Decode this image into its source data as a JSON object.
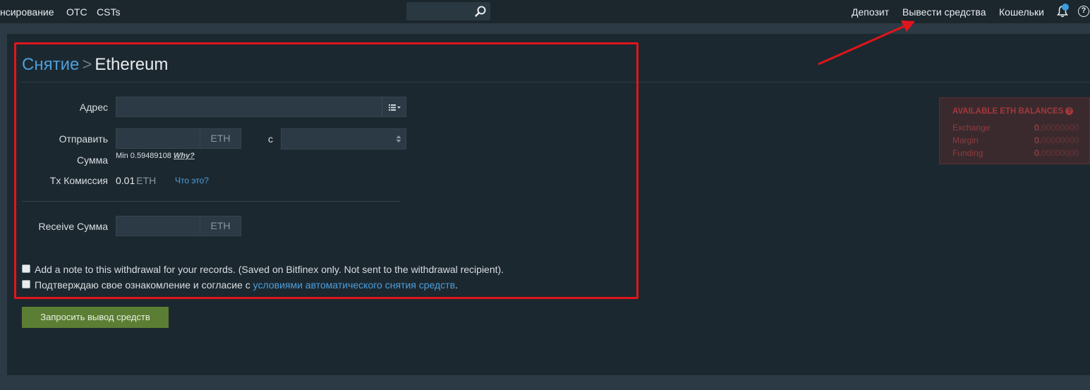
{
  "nav": {
    "left_items": [
      "нсирование",
      "OTC",
      "CSTs"
    ],
    "right_items": [
      "Депозит",
      "Вывести средства",
      "Кошельки"
    ]
  },
  "breadcrumb": {
    "parent": "Снятие",
    "separator": ">",
    "current": "Ethereum"
  },
  "form": {
    "address_label": "Адрес",
    "send_label_1": "Отправить",
    "send_label_2": "Сумма",
    "currency": "ETH",
    "from_label": "с",
    "min_text": "Min 0.59489108",
    "why_link": "Why?",
    "fee_label": "Tx Комиссия",
    "fee_value": "0.01",
    "fee_unit": "ETH",
    "fee_help_link": "Что это?",
    "receive_label": "Receive Сумма",
    "note_checkbox_text": "Add a note to this withdrawal for your records. (Saved on Bitfinex only. Not sent to the withdrawal recipient).",
    "terms_text_before": "Подтверждаю свое ознакомление и согласие с ",
    "terms_link": "условиями автоматического снятия средств",
    "terms_text_after": ".",
    "submit_label": "Запросить вывод средств"
  },
  "balances": {
    "title": "AVAILABLE ETH BALANCES",
    "rows": [
      {
        "label": "Exchange",
        "int": "0.",
        "dec": "00000000"
      },
      {
        "label": "Margin",
        "int": "0.",
        "dec": "00000000"
      },
      {
        "label": "Funding",
        "int": "0.",
        "dec": "00000000"
      }
    ]
  },
  "colors": {
    "accent_link": "#4c9fdc",
    "submit_green": "#5b7e34",
    "annotation_red": "#e0151b",
    "balance_red": "#a5373b"
  },
  "icons": [
    "search-icon",
    "list-icon",
    "bell-icon",
    "help-icon",
    "select-arrows-icon",
    "question-circle-icon"
  ]
}
